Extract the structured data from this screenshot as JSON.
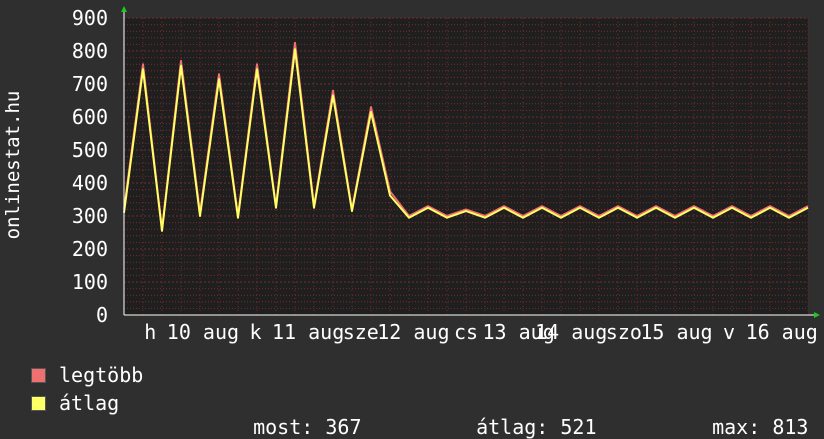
{
  "chart_data": {
    "type": "line",
    "ylabel": "onlinestat.hu",
    "ylim": [
      0,
      900
    ],
    "yticks": [
      0,
      100,
      200,
      300,
      400,
      500,
      600,
      700,
      800,
      900
    ],
    "xtick_labels": [
      "h",
      "10 aug",
      "k",
      "11 aug",
      "sze",
      "12 aug",
      "cs",
      "13 aug",
      "14 aug",
      "szo",
      "15 aug",
      "v",
      "16 aug"
    ],
    "grid": true,
    "colors": {
      "background": "#2f2f2f",
      "plot_background": "#1f1f1f",
      "grid": "#7a2b2b",
      "legtobb": "#f07070",
      "atlag": "#ffff66",
      "axis_arrow": "#1ec81e"
    },
    "x": [
      0,
      0.2,
      0.4,
      0.6,
      0.8,
      1,
      1.2,
      1.4,
      1.6,
      1.8,
      2,
      2.2,
      2.4,
      2.6,
      2.8,
      3,
      3.2,
      3.4,
      3.6,
      3.8,
      4,
      4.2,
      4.4,
      4.6,
      4.8,
      5,
      5.2,
      5.4,
      5.6,
      5.8,
      6,
      6.2,
      6.4,
      6.6,
      6.8,
      7,
      7.2
    ],
    "series": [
      {
        "name": "legtöbb",
        "values": [
          320,
          760,
          260,
          770,
          310,
          730,
          300,
          760,
          330,
          825,
          330,
          680,
          320,
          630,
          375,
          300,
          330,
          300,
          320,
          300,
          330,
          300,
          330,
          300,
          330,
          300,
          330,
          300,
          330,
          300,
          330,
          300,
          330,
          300,
          330,
          300,
          330
        ]
      },
      {
        "name": "átlag",
        "values": [
          310,
          745,
          255,
          755,
          300,
          715,
          295,
          745,
          325,
          805,
          325,
          665,
          315,
          615,
          362,
          295,
          325,
          295,
          315,
          295,
          325,
          295,
          325,
          295,
          325,
          295,
          325,
          295,
          325,
          295,
          325,
          295,
          325,
          295,
          325,
          295,
          325
        ]
      }
    ]
  },
  "legend": {
    "items": [
      {
        "label": "legtöbb",
        "color": "#f07070"
      },
      {
        "label": "átlag",
        "color": "#ffff66"
      }
    ],
    "stats": {
      "most_label": "most:",
      "most_value": "367",
      "atlag_label": "átlag:",
      "atlag_value": "521",
      "max_label": "max:",
      "max_value": "813"
    }
  }
}
